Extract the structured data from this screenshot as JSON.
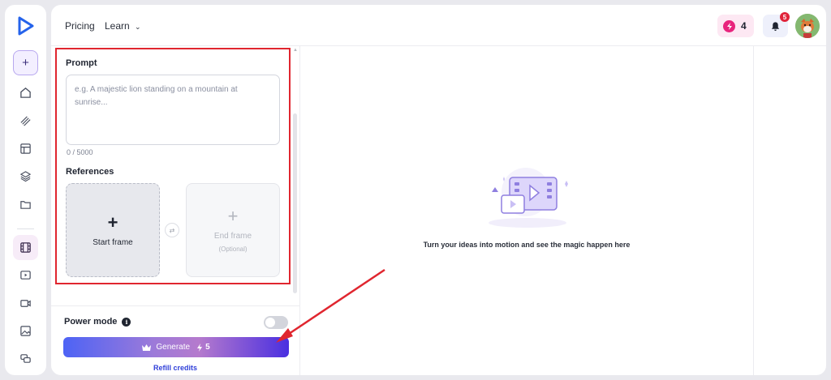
{
  "nav": {
    "pricing": "Pricing",
    "learn": "Learn"
  },
  "header": {
    "credits": "4",
    "notifications": "5"
  },
  "prompt": {
    "label": "Prompt",
    "placeholder": "e.g. A majestic lion standing on a mountain at sunrise...",
    "counter": "0 / 5000"
  },
  "references": {
    "label": "References",
    "start_frame": "Start frame",
    "end_frame": "End frame",
    "end_frame_note": "(Optional)"
  },
  "power_mode": {
    "label": "Power mode",
    "enabled": false
  },
  "generate": {
    "label": "Generate",
    "cost": "5"
  },
  "refill": "Refill credits",
  "preview": {
    "message": "Turn your ideas into motion and see the magic happen here"
  },
  "icons": {
    "rail": [
      "logo-icon",
      "plus-icon",
      "home-icon",
      "satellite-icon",
      "layout-icon",
      "layers-icon",
      "folder-icon",
      "film-icon",
      "video-icon",
      "video-plus-icon",
      "image-icon",
      "chat-icon"
    ]
  },
  "colors": {
    "accent": "#4d63f5",
    "credits_bg": "#fde8f3",
    "notification": "#e0243a",
    "annotation": "#e0262f"
  }
}
